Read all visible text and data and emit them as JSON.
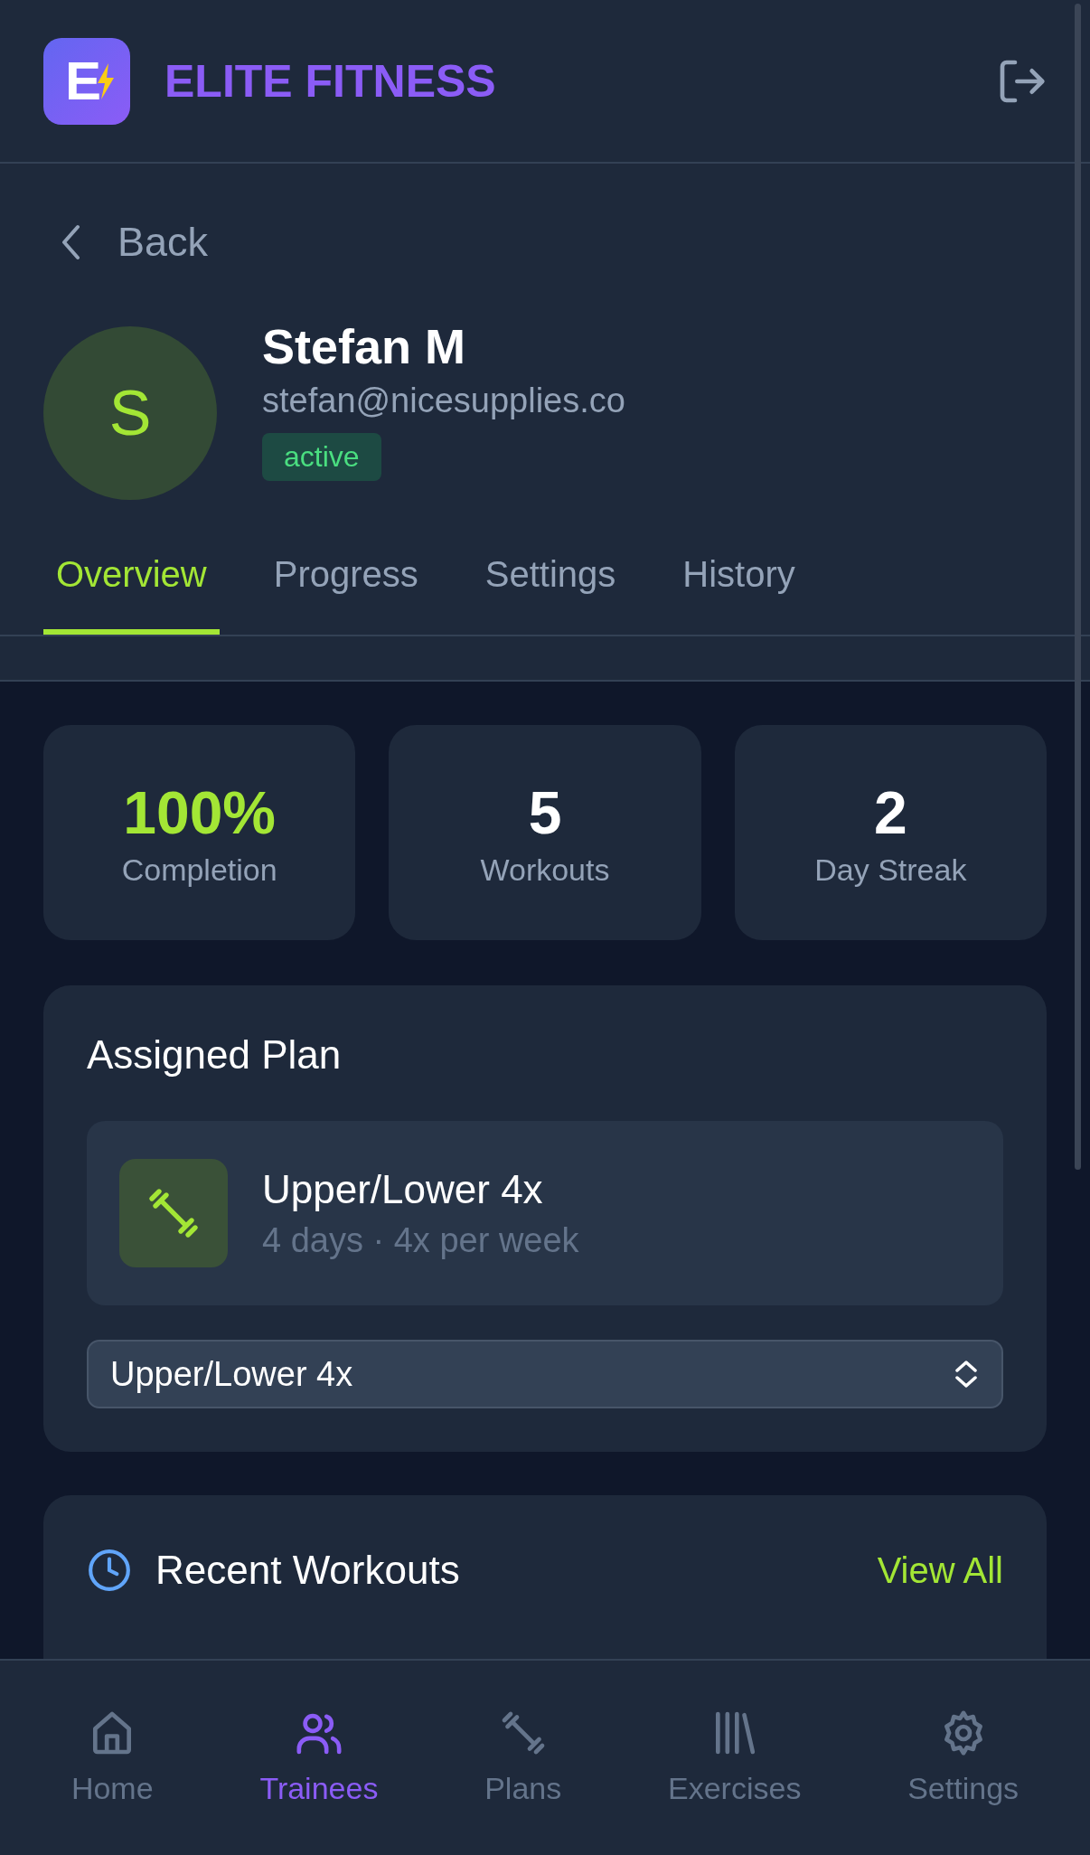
{
  "app": {
    "logo_letter": "E",
    "title": "ELITE FITNESS"
  },
  "back": {
    "label": "Back"
  },
  "profile": {
    "initial": "S",
    "name": "Stefan M",
    "email": "stefan@nicesupplies.co",
    "status": "active"
  },
  "tabs": [
    {
      "label": "Overview",
      "selected": true
    },
    {
      "label": "Progress",
      "selected": false
    },
    {
      "label": "Settings",
      "selected": false
    },
    {
      "label": "History",
      "selected": false
    }
  ],
  "stats": [
    {
      "value": "100%",
      "label": "Completion",
      "accent": true
    },
    {
      "value": "5",
      "label": "Workouts",
      "accent": false
    },
    {
      "value": "2",
      "label": "Day Streak",
      "accent": false
    }
  ],
  "assigned_plan": {
    "title": "Assigned Plan",
    "plan": {
      "name": "Upper/Lower 4x",
      "details": "4 days · 4x per week"
    },
    "select": {
      "value": "Upper/Lower 4x"
    }
  },
  "recent_workouts": {
    "title": "Recent Workouts",
    "link": "View All"
  },
  "nav": [
    {
      "label": "Home",
      "kind": "home",
      "selected": false
    },
    {
      "label": "Trainees",
      "kind": "users",
      "selected": true
    },
    {
      "label": "Plans",
      "kind": "dumbbell",
      "selected": false
    },
    {
      "label": "Exercises",
      "kind": "library",
      "selected": false
    },
    {
      "label": "Settings",
      "kind": "gear",
      "selected": false
    }
  ]
}
